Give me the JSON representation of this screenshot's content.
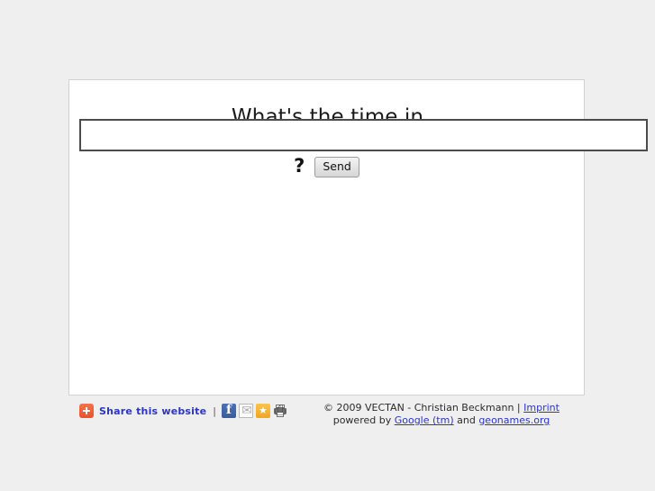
{
  "page": {
    "background_color": "#efefef",
    "panel_background": "#ffffff",
    "link_color": "#2b35c8"
  },
  "main": {
    "title": "What's the time in",
    "search": {
      "value": "",
      "placeholder": ""
    },
    "question_mark": "?",
    "send_label": "Send"
  },
  "footer": {
    "share": {
      "plus_icon": "addthis-plus-icon",
      "label": "Share this website",
      "divider": "|",
      "icons": [
        {
          "name": "facebook-icon",
          "label": "Facebook"
        },
        {
          "name": "email-icon",
          "label": "Email"
        },
        {
          "name": "favorites-star-icon",
          "label": "Favorites"
        },
        {
          "name": "print-icon",
          "label": "Print"
        }
      ]
    },
    "credits": {
      "line1_prefix": "© 2009 VECTAN - Christian Beckmann | ",
      "imprint_link": "Imprint",
      "line2_prefix": "powered by ",
      "google_link": "Google (tm)",
      "line2_middle": " and ",
      "geonames_link": "geonames.org"
    }
  }
}
